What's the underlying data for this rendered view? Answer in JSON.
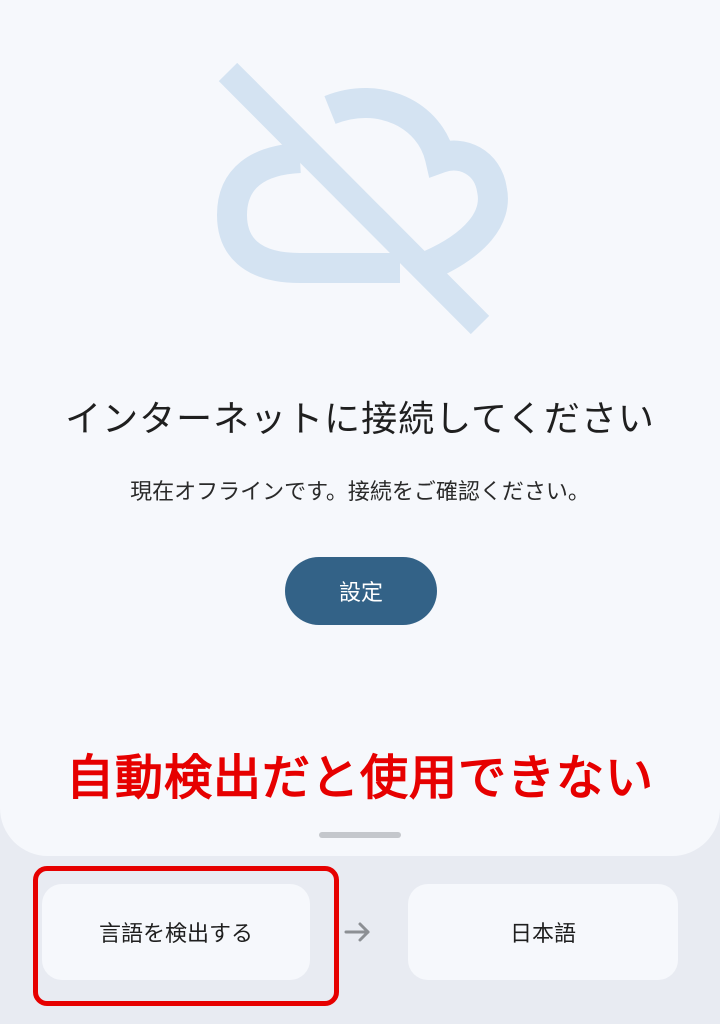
{
  "offline": {
    "title": "インターネットに接続してください",
    "subtitle": "現在オフラインです。接続をご確認ください。",
    "settings_label": "設定",
    "icon": "cloud-off-icon"
  },
  "annotation": {
    "text": "自動検出だと使用できない",
    "color": "#e60000"
  },
  "language_bar": {
    "source": "言語を検出する",
    "target": "日本語",
    "swap_icon": "arrow-right-icon"
  },
  "colors": {
    "accent": "#336287",
    "illustration": "#d4e3f2",
    "highlight": "#e60000"
  }
}
